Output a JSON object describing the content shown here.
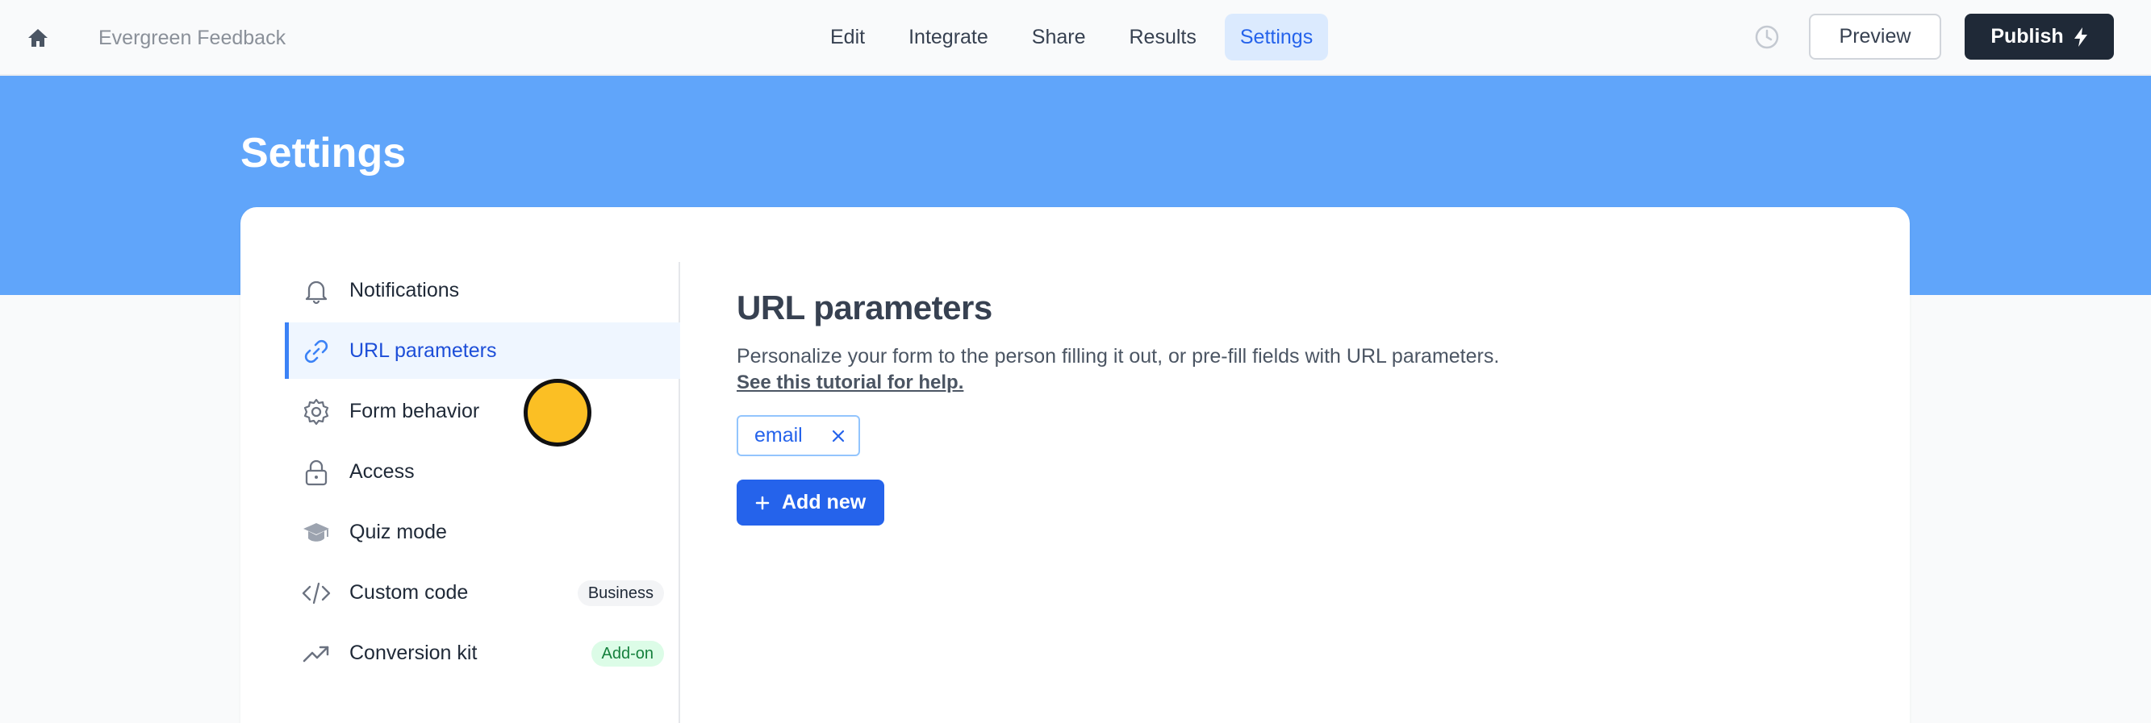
{
  "topbar": {
    "app_title": "Evergreen Feedback",
    "home_icon": "home-icon",
    "nav": [
      {
        "label": "Edit",
        "active": false
      },
      {
        "label": "Integrate",
        "active": false
      },
      {
        "label": "Share",
        "active": false
      },
      {
        "label": "Results",
        "active": false
      },
      {
        "label": "Settings",
        "active": true
      }
    ],
    "history_icon": "clock-icon",
    "preview_label": "Preview",
    "publish_label": "Publish",
    "publish_icon": "lightning-icon"
  },
  "page": {
    "title": "Settings",
    "banner_color": "#60a5fa"
  },
  "sidebar": {
    "items": [
      {
        "label": "Notifications",
        "icon": "bell-icon",
        "active": false
      },
      {
        "label": "URL parameters",
        "icon": "link-icon",
        "active": true
      },
      {
        "label": "Form behavior",
        "icon": "gear-icon",
        "active": false
      },
      {
        "label": "Access",
        "icon": "lock-icon",
        "active": false
      },
      {
        "label": "Quiz mode",
        "icon": "graduation-cap-icon",
        "active": false
      },
      {
        "label": "Custom code",
        "icon": "code-icon",
        "active": false,
        "badge": "Business"
      },
      {
        "label": "Conversion kit",
        "icon": "trending-up-icon",
        "active": false,
        "badge": "Add-on"
      }
    ]
  },
  "main": {
    "title": "URL parameters",
    "description": "Personalize your form to the person filling it out, or pre-fill fields with URL parameters.",
    "tutorial_link": "See this tutorial for help.",
    "parameters": [
      {
        "name": "email"
      }
    ],
    "add_button_label": "Add new"
  },
  "colors": {
    "accent": "#2563eb",
    "dark": "#1f2937",
    "addon_badge": "#dcfce7"
  }
}
